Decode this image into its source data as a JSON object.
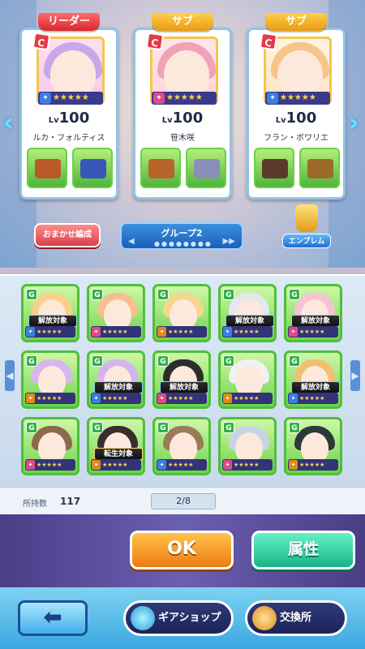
{
  "team": {
    "slots": [
      {
        "tag": "リーダー",
        "level_prefix": "Lv",
        "level": "100",
        "name": "ルカ・フォルティス",
        "rank": "C",
        "stars": "★★★★★",
        "hair": "#c9a7e8"
      },
      {
        "tag": "サブ",
        "level_prefix": "Lv",
        "level": "100",
        "name": "笹木咲",
        "rank": "C",
        "stars": "★★★★★",
        "hair": "#f2a2b6"
      },
      {
        "tag": "サブ",
        "level_prefix": "Lv",
        "level": "100",
        "name": "フラン・ボワリエ",
        "rank": "C",
        "stars": "★★★★★",
        "hair": "#f7c58a"
      }
    ]
  },
  "controls": {
    "auto_label": "おまかせ編成",
    "group_label": "グループ2",
    "group_dots": "●●●●●●●●",
    "emblem_label": "エンブレム",
    "collapse": "︽"
  },
  "list": {
    "tiles": [
      {
        "hair": "#f7d08a",
        "ribbon": "解放対象",
        "kind": "release"
      },
      {
        "hair": "#f4c08e",
        "ribbon": "",
        "kind": ""
      },
      {
        "hair": "#f6d68e",
        "ribbon": "",
        "kind": ""
      },
      {
        "hair": "#e6e6ef",
        "ribbon": "解放対象",
        "kind": "release"
      },
      {
        "hair": "#f6c2d4",
        "ribbon": "解放対象",
        "kind": "release"
      },
      {
        "hair": "#d7b6f0",
        "ribbon": "",
        "kind": ""
      },
      {
        "hair": "#d4b4ee",
        "ribbon": "解放対象",
        "kind": "release"
      },
      {
        "hair": "#2d2d2d",
        "ribbon": "解放対象",
        "kind": "release"
      },
      {
        "hair": "#f1f1f1",
        "ribbon": "",
        "kind": ""
      },
      {
        "hair": "#f0c075",
        "ribbon": "解放対象",
        "kind": "release"
      },
      {
        "hair": "#8b6a4a",
        "ribbon": "",
        "kind": ""
      },
      {
        "hair": "#3a2d2d",
        "ribbon": "転生対象",
        "kind": "rebirth"
      },
      {
        "hair": "#9b7a5a",
        "ribbon": "",
        "kind": ""
      },
      {
        "hair": "#c9d3e8",
        "ribbon": "",
        "kind": ""
      },
      {
        "hair": "#2e3a3a",
        "ribbon": "",
        "kind": ""
      }
    ],
    "tile_rank": "G",
    "tile_stars": "★★★★★",
    "left_arrow": "◀",
    "right_arrow": "▶"
  },
  "counts": {
    "label": "所持数",
    "owned": "117",
    "page": "2/8"
  },
  "actions": {
    "ok": "OK",
    "attribute": "属性"
  },
  "bottom": {
    "back": "⬅",
    "gear_shop": "ギアショップ",
    "exchange": "交換所"
  },
  "colors": {
    "leader_tag": "#d8262f",
    "sub_tag": "#e89a10",
    "ok": "#ee7c12",
    "attribute": "#18b487"
  }
}
